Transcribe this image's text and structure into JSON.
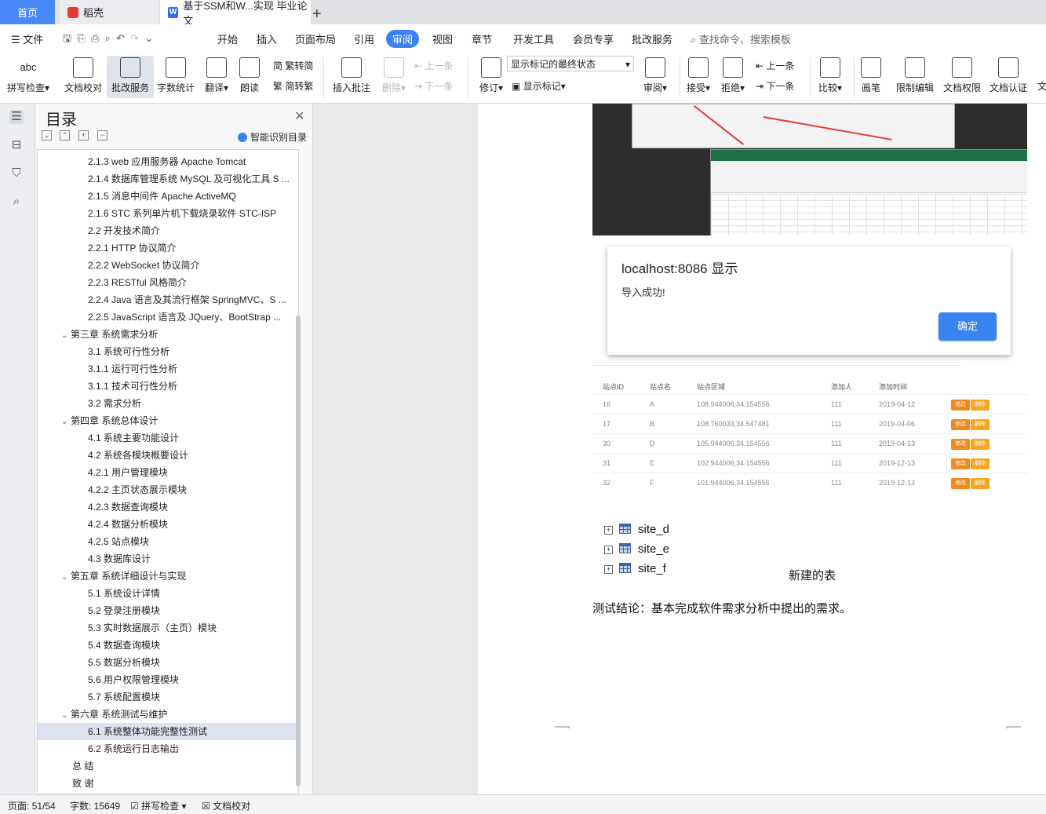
{
  "tabs": {
    "home": "首页",
    "daoke": "稻壳",
    "document": "基于SSM和W...实现 毕业论文",
    "add": "+"
  },
  "menu": {
    "file": "文件",
    "items": [
      "开始",
      "插入",
      "页面布局",
      "引用",
      "审阅",
      "视图",
      "章节",
      "开发工具",
      "会员专享",
      "批改服务"
    ],
    "active": "审阅",
    "search": "查找命令、搜索模板"
  },
  "ribbon": {
    "spellcheck": "拼写检查",
    "doc_proof": "文档校对",
    "grading": "批改服务",
    "word_count": "字数统计",
    "translate": "翻译",
    "read_aloud": "朗读",
    "trad_to_simp": "繁转简",
    "simp_to_trad": "简转繁",
    "insert_comment": "插入批注",
    "delete": "删除",
    "prev": "上一条",
    "next": "下一条",
    "revise": "修订",
    "markup_state": "显示标记的最终状态",
    "show_markup": "显示标记",
    "review": "审阅",
    "accept": "接受",
    "reject": "拒绝",
    "prev2": "上一条",
    "next2": "下一条",
    "compare": "比较",
    "pen": "画笔",
    "restrict_edit": "限制编辑",
    "doc_permission": "文档权限",
    "doc_cert": "文档认证",
    "more": "文"
  },
  "toc": {
    "title": "目录",
    "smart": "智能识别目录",
    "items": [
      {
        "text": "2.1.3 web 应用服务器 Apache Tomcat",
        "level": 3
      },
      {
        "text": "2.1.4 数据库管理系统 MySQL 及可视化工具 S ...",
        "level": 3
      },
      {
        "text": "2.1.5 消息中间件 Apache ActiveMQ",
        "level": 3
      },
      {
        "text": "2.1.6 STC 系列单片机下载烧录软件 STC-ISP",
        "level": 3
      },
      {
        "text": "2.2 开发技术简介",
        "level": 3
      },
      {
        "text": "2.2.1 HTTP 协议简介",
        "level": 3
      },
      {
        "text": "2.2.2 WebSocket 协议简介",
        "level": 3
      },
      {
        "text": "2.2.3 RESTful 风格简介",
        "level": 3
      },
      {
        "text": "2.2.4 Java 语言及其流行框架 SpringMVC、S ...",
        "level": 3
      },
      {
        "text": "2.2.5 JavaScript 语言及 JQuery、BootStrap ...",
        "level": 3
      },
      {
        "text": "第三章 系统需求分析",
        "level": 1
      },
      {
        "text": "3.1 系统可行性分析",
        "level": 3
      },
      {
        "text": "3.1.1 运行可行性分析",
        "level": 3
      },
      {
        "text": "3.1.1 技术可行性分析",
        "level": 3
      },
      {
        "text": "3.2 需求分析",
        "level": 3
      },
      {
        "text": "第四章 系统总体设计",
        "level": 1
      },
      {
        "text": "4.1 系统主要功能设计",
        "level": 3
      },
      {
        "text": "4.2 系统各模块概要设计",
        "level": 3
      },
      {
        "text": "4.2.1 用户管理模块",
        "level": 3
      },
      {
        "text": "4.2.2 主页状态展示模块",
        "level": 3
      },
      {
        "text": "4.2.3 数据查询模块",
        "level": 3
      },
      {
        "text": "4.2.4 数据分析模块",
        "level": 3
      },
      {
        "text": "4.2.5 站点模块",
        "level": 3
      },
      {
        "text": "4.3 数据库设计",
        "level": 3
      },
      {
        "text": "第五章 系统详细设计与实现",
        "level": 1
      },
      {
        "text": "5.1 系统设计详情",
        "level": 3
      },
      {
        "text": "5.2 登录注册模块",
        "level": 3
      },
      {
        "text": "5.3 实时数据展示（主页）模块",
        "level": 3
      },
      {
        "text": "5.4 数据查询模块",
        "level": 3
      },
      {
        "text": "5.5 数据分析模块",
        "level": 3
      },
      {
        "text": "5.6 用户权限管理模块",
        "level": 3
      },
      {
        "text": "5.7 系统配置模块",
        "level": 3
      },
      {
        "text": "第六章 系统测试与维护",
        "level": 1
      },
      {
        "text": "6.1 系统整体功能完整性测试",
        "level": 3,
        "selected": true
      },
      {
        "text": "6.2 系统运行日志输出",
        "level": 3
      },
      {
        "text": "总 结",
        "level": 0
      },
      {
        "text": "致 谢",
        "level": 0
      }
    ]
  },
  "alert": {
    "title": "localhost:8086 显示",
    "message": "导入成功!",
    "ok": "确定"
  },
  "site_table": {
    "headers": [
      "站点ID",
      "站点名",
      "站点区域",
      "添加人",
      "添加时间"
    ],
    "rows": [
      {
        "id": "16",
        "name": "A",
        "area": "108.944006,34.154556",
        "by": "111",
        "time": "2019-04-12"
      },
      {
        "id": "17",
        "name": "B",
        "area": "108.760033,34.547481",
        "by": "111",
        "time": "2019-04-06"
      },
      {
        "id": "30",
        "name": "D",
        "area": "105.944006,34.154556",
        "by": "111",
        "time": "2019-04-13"
      },
      {
        "id": "31",
        "name": "E",
        "area": "102.944006,34.154556",
        "by": "111",
        "time": "2019-12-13"
      },
      {
        "id": "32",
        "name": "F",
        "area": "101.944006,34.154556",
        "by": "111",
        "time": "2019-12-13"
      }
    ],
    "edit": "修改",
    "delete": "删除"
  },
  "tables_tree": [
    "site_d",
    "site_e",
    "site_f"
  ],
  "caption": "新建的表",
  "conclusion": "测试结论：基本完成软件需求分析中提出的需求。",
  "status": {
    "page": "页面: 51/54",
    "words": "字数: 15649",
    "spellcheck": "拼写检查",
    "proof": "文档校对"
  }
}
